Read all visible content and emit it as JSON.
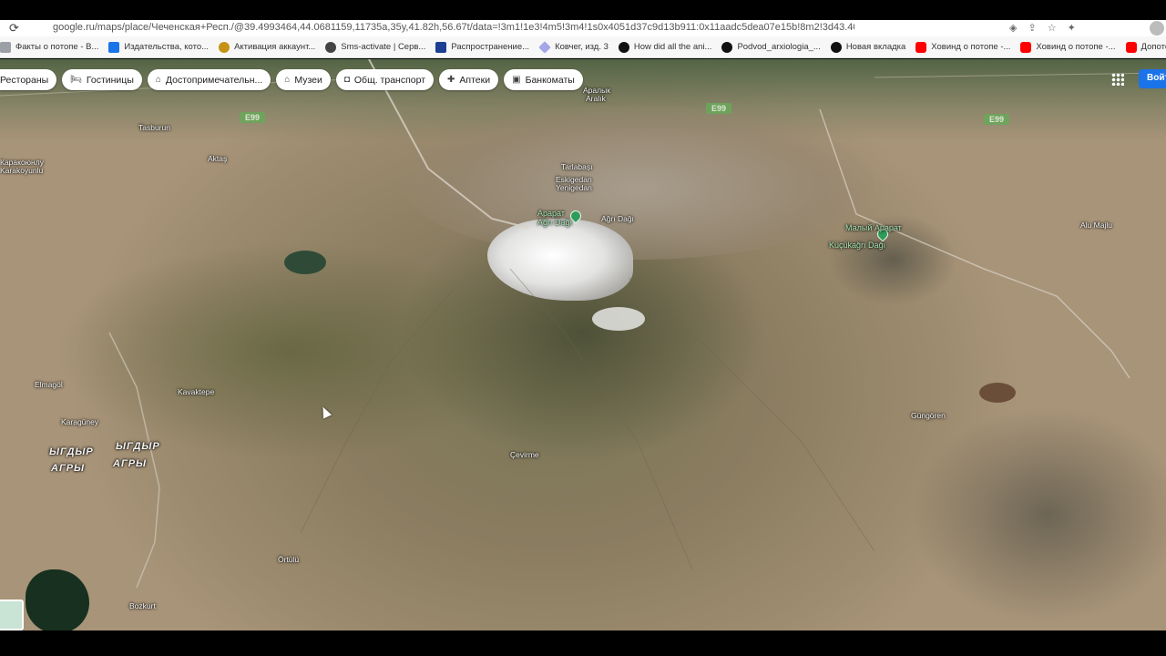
{
  "browser": {
    "url": "google.ru/maps/place/Чеченская+Респ./@39.4993464,44.0681159,11735a,35y,41.82h,56.67t/data=!3m1!1e3!4m5!3m4!1s0x4051d37c9d13b911:0x11aadc5dea07e15b!8m2!3d43.4023301!4d45.7187468",
    "bookmarks": [
      {
        "label": "Факты о потопе - В...",
        "icon": "bookmark-icon",
        "color": "#9aa0a6"
      },
      {
        "label": "Издательства, кото...",
        "icon": "x-site-icon",
        "color": "#1a73e8"
      },
      {
        "label": "Активация аккаунт...",
        "icon": "crest-icon",
        "color": "#c69214"
      },
      {
        "label": "Sms-activate | Серв...",
        "icon": "sms-icon",
        "color": "#444444"
      },
      {
        "label": "Распространение...",
        "icon": "site-icon",
        "color": "#1c3f94"
      },
      {
        "label": "Ковчег, изд. 3",
        "icon": "diamond-icon",
        "color": "#a4a6e8"
      },
      {
        "label": "How did all the ani...",
        "icon": "question-icon",
        "color": "#111111"
      },
      {
        "label": "Podvod_arxiologia_...",
        "icon": "github-icon",
        "color": "#111111"
      },
      {
        "label": "Новая вкладка",
        "icon": "github-icon",
        "color": "#111111"
      },
      {
        "label": "Ховинд о потопе -...",
        "icon": "youtube-icon",
        "color": "#ff0000"
      },
      {
        "label": "Ховинд о потопе -...",
        "icon": "youtube-icon",
        "color": "#ff0000"
      },
      {
        "label": "Допотопные техно...",
        "icon": "youtube-icon",
        "color": "#ff0000"
      }
    ]
  },
  "chips": [
    {
      "label": "Рестораны",
      "icon": "restaurant-icon"
    },
    {
      "label": "Гостиницы",
      "icon": "hotel-icon"
    },
    {
      "label": "Достопримечательн...",
      "icon": "attraction-icon"
    },
    {
      "label": "Музеи",
      "icon": "museum-icon"
    },
    {
      "label": "Общ. транспорт",
      "icon": "transit-icon"
    },
    {
      "label": "Аптеки",
      "icon": "pharmacy-icon"
    },
    {
      "label": "Банкоматы",
      "icon": "atm-icon"
    }
  ],
  "login_label": "Войти",
  "map": {
    "road_badges": [
      "E99",
      "E99",
      "E99"
    ],
    "labels": {
      "tasburun": "Tasburun",
      "aktas": "Aktaş",
      "karakoyunlu_ru": "Каракоюнлу",
      "karakoyunlu": "Karakoyunlu",
      "aralik_ru": "Аралык",
      "aralik": "Aralık",
      "tarlabasi": "Tarlabaşı",
      "eskigedan": "Eskigedan",
      "yenigedan": "Yenigedan",
      "ararat_ru": "Арарат",
      "ararat": "Ağrı Dağı",
      "ararat_small": "Ağrı Dağı",
      "maly_ararat_ru": "Малый Арарат",
      "kucuk_agri": "Küçükağrı Dağı",
      "alu_majlu": "Alu Majlu",
      "elmagol": "Elmagöl",
      "kavaktepe": "Kavaktepe",
      "karaguney": "Karagüney",
      "yigdir1": "ЫГДЫР",
      "agry1": "АГРЫ",
      "yigdir2": "ЫГДЫР",
      "agry2": "АГРЫ",
      "cevirme": "Çevirme",
      "gungoren": "Güngören",
      "ortulu": "Örtülü",
      "bozkurt": "Bozkurt"
    }
  }
}
